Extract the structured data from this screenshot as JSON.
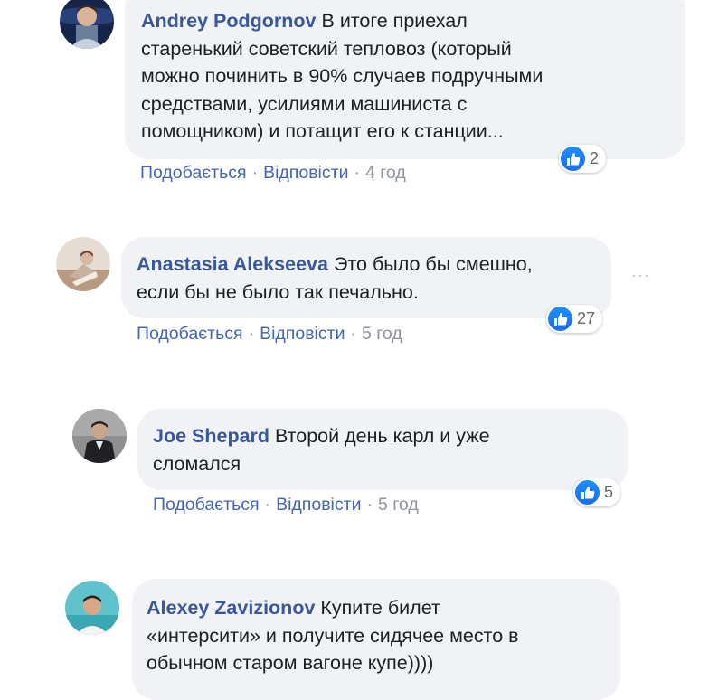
{
  "comments": [
    {
      "author": "Andrey Podgornov",
      "text": "В итоге приехал старенький советский тепловоз (который можно починить в 90% случаев подручными средствами, усилиями машиниста с помощником) и потащит его к станции...",
      "lines": [
        "В итоге приехал",
        "старенький советский тепловоз (который",
        "можно починить в 90% случаев подручными",
        "средствами, усилиями машиниста с",
        "помощником) и потащит его к станции..."
      ],
      "like_label": "Подобається",
      "reply_label": "Відповісти",
      "time": "4 год",
      "reactions": "2",
      "avatar_icon": "user-avatar-icon"
    },
    {
      "author": "Anastasia Alekseeva",
      "text": "Это было бы смешно, если бы не было так печально.",
      "lines": [
        "Это было бы смешно,",
        "если бы не было так печально."
      ],
      "like_label": "Подобається",
      "reply_label": "Відповісти",
      "time": "5 год",
      "reactions": "27",
      "more_label": "···",
      "avatar_icon": "user-avatar-icon"
    },
    {
      "author": "Joe Shepard",
      "text": "Второй день карл и уже сломался",
      "lines": [
        "Второй день карл и уже",
        "сломался"
      ],
      "like_label": "Подобається",
      "reply_label": "Відповісти",
      "time": "5 год",
      "reactions": "5",
      "avatar_icon": "user-avatar-icon"
    },
    {
      "author": "Alexey Zavizionov",
      "text": "Купите билет «интерсити» и получите сидячее место в обычном старом вагоне купе))))",
      "lines": [
        "Купите билет",
        "«интерсити» и получите сидячее место в",
        "обычном старом вагоне купе))))"
      ],
      "avatar_icon": "user-avatar-icon"
    }
  ],
  "separator": "·",
  "colors": {
    "bubble": "#f0f2f5",
    "author": "#385898",
    "link": "#4267b2",
    "meta": "#90949c",
    "like_blue": "#1877f2"
  },
  "icons": {
    "like": "thumbs-up-icon",
    "more": "more-options-icon"
  }
}
